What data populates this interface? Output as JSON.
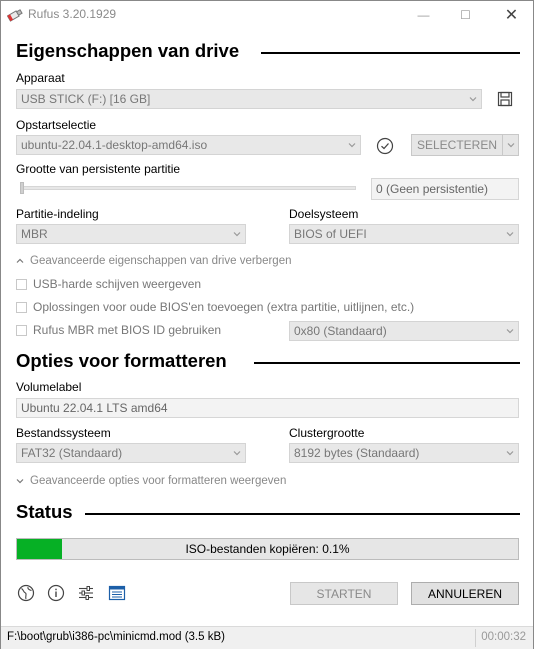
{
  "window": {
    "title": "Rufus 3.20.1929",
    "minimize_glyph": "—",
    "maximize_glyph": "☐",
    "close_glyph": "✕"
  },
  "drive_properties": {
    "heading": "Eigenschappen van drive",
    "device_label": "Apparaat",
    "device_value": "USB STICK (F:) [16 GB]",
    "boot_selection_label": "Opstartselectie",
    "boot_selection_value": "ubuntu-22.04.1-desktop-amd64.iso",
    "select_button": "SELECTEREN",
    "persistent_label": "Grootte van persistente partitie",
    "persistent_value": "0 (Geen persistentie)",
    "persistent_level": 0,
    "partition_scheme_label": "Partitie-indeling",
    "partition_scheme_value": "MBR",
    "target_system_label": "Doelsysteem",
    "target_system_value": "BIOS of UEFI",
    "advanced_toggle": "Geavanceerde eigenschappen van drive verbergen",
    "checkbox_usb_hdd": "USB-harde schijven weergeven",
    "checkbox_old_bios": "Oplossingen voor oude BIOS'en toevoegen (extra partitie, uitlijnen, etc.)",
    "checkbox_rufus_mbr": "Rufus MBR met BIOS ID gebruiken",
    "bios_id_value": "0x80 (Standaard)"
  },
  "format_options": {
    "heading": "Opties voor formatteren",
    "volume_label_label": "Volumelabel",
    "volume_label_value": "Ubuntu 22.04.1 LTS amd64",
    "filesystem_label": "Bestandssysteem",
    "filesystem_value": "FAT32 (Standaard)",
    "cluster_label": "Clustergrootte",
    "cluster_value": "8192 bytes (Standaard)",
    "advanced_toggle": "Geavanceerde opties voor formatteren weergeven"
  },
  "status": {
    "heading": "Status",
    "progress_text": "ISO-bestanden kopiëren: 0.1%",
    "progress_fraction": 0.09,
    "progress_color": "#06b025"
  },
  "toolbar": {
    "icons": [
      "globe-icon",
      "info-icon",
      "settings-sliders-icon",
      "log-icon"
    ]
  },
  "actions": {
    "start_button": "STARTEN",
    "cancel_button": "ANNULEREN"
  },
  "statusbar": {
    "text": "F:\\boot\\grub\\i386-pc\\minicmd.mod (3.5 kB)",
    "elapsed": "00:00:32"
  }
}
